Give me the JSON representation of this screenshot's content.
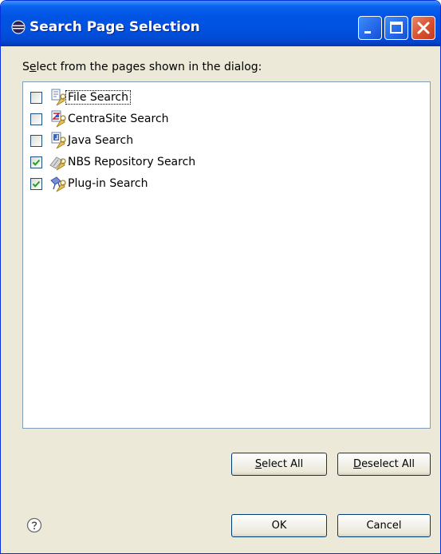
{
  "window": {
    "title": "Search Page Selection",
    "title_icon": "eclipse-icon",
    "controls": [
      "minimize-icon",
      "maximize-icon",
      "close-icon"
    ]
  },
  "dialog": {
    "instruction_prefix": "S",
    "instruction_mnemonic": "e",
    "instruction_suffix": "lect from the pages shown in the dialog:"
  },
  "pages": [
    {
      "label": "File Search",
      "checked": false,
      "icon": "file-search-icon",
      "focused": true
    },
    {
      "label": "CentraSite Search",
      "checked": false,
      "icon": "centrasite-search-icon",
      "focused": false
    },
    {
      "label": "Java Search",
      "checked": false,
      "icon": "java-search-icon",
      "focused": false
    },
    {
      "label": "NBS Repository Search",
      "checked": true,
      "icon": "repository-search-icon",
      "focused": false
    },
    {
      "label": "Plug-in Search",
      "checked": true,
      "icon": "plugin-search-icon",
      "focused": false
    }
  ],
  "buttons": {
    "select_all_mnemonic": "S",
    "select_all_rest": "elect All",
    "deselect_all_mnemonic": "D",
    "deselect_all_rest": "eselect All",
    "ok": "OK",
    "cancel": "Cancel"
  },
  "help_icon": "help-icon",
  "colors": {
    "titlebar": "#0054e3",
    "dialog_bg": "#ece9d8",
    "checkmark": "#21a121",
    "close_button": "#d9502f"
  }
}
